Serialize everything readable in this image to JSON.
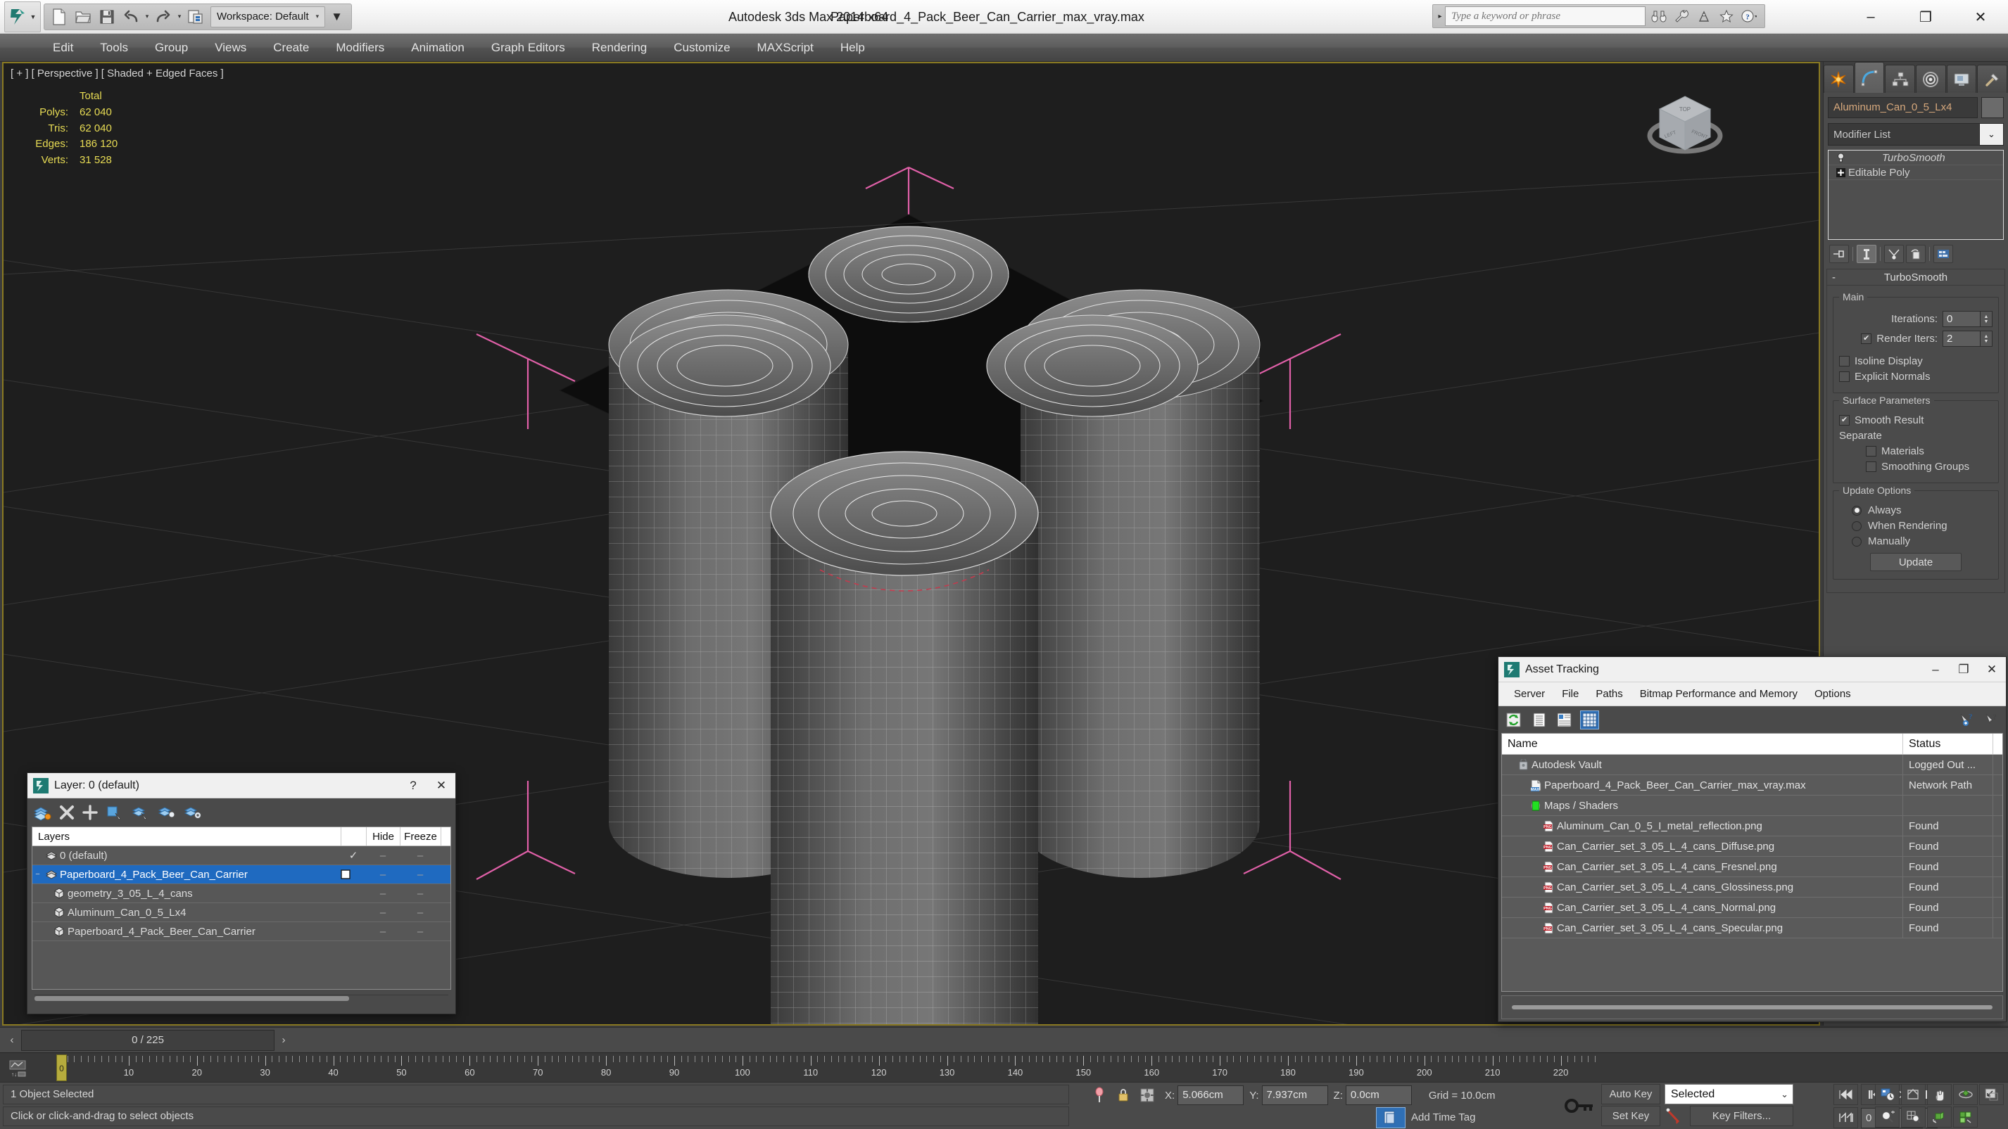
{
  "titlebar": {
    "app_title": "Autodesk 3ds Max  2014 x64",
    "file_title": "Paperboard_4_Pack_Beer_Can_Carrier_max_vray.max",
    "workspace_label": "Workspace: Default",
    "search_placeholder": "Type a keyword or phrase",
    "qat": [
      {
        "name": "new-file",
        "icon": "new-file-icon"
      },
      {
        "name": "open-file",
        "icon": "open-folder-icon"
      },
      {
        "name": "save-file",
        "icon": "save-disk-icon"
      },
      {
        "name": "undo",
        "icon": "undo-arrow-icon"
      },
      {
        "name": "redo",
        "icon": "redo-arrow-icon"
      },
      {
        "name": "project-folder",
        "icon": "project-folder-icon"
      }
    ],
    "search_icons": [
      "binoculars-icon",
      "wrench-icon",
      "satellite-icon",
      "star-icon",
      "help-circle-icon"
    ],
    "window_buttons": {
      "minimize": "–",
      "maximize": "❐",
      "close": "✕"
    }
  },
  "menubar": {
    "items": [
      "Edit",
      "Tools",
      "Group",
      "Views",
      "Create",
      "Modifiers",
      "Animation",
      "Graph Editors",
      "Rendering",
      "Customize",
      "MAXScript",
      "Help"
    ]
  },
  "viewport": {
    "label": "[ + ] [ Perspective ] [ Shaded + Edged Faces ]",
    "stats": {
      "header": "Total",
      "rows": [
        {
          "key": "Polys:",
          "value": "62 040"
        },
        {
          "key": "Tris:",
          "value": "62 040"
        },
        {
          "key": "Edges:",
          "value": "186 120"
        },
        {
          "key": "Verts:",
          "value": "31 528"
        }
      ]
    },
    "viewcube_faces": {
      "top": "TOP",
      "left": "LEFT",
      "front": "FRONT"
    }
  },
  "command_panel": {
    "tabs": [
      {
        "name": "create-tab",
        "icon": "create-star-icon",
        "active": false
      },
      {
        "name": "modify-tab",
        "icon": "modify-curve-icon",
        "active": true
      },
      {
        "name": "hierarchy-tab",
        "icon": "hierarchy-icon",
        "active": false
      },
      {
        "name": "motion-tab",
        "icon": "motion-wheel-icon",
        "active": false
      },
      {
        "name": "display-tab",
        "icon": "display-monitor-icon",
        "active": false
      },
      {
        "name": "utilities-tab",
        "icon": "utilities-hammer-icon",
        "active": false
      }
    ],
    "object_name": "Aluminum_Can_0_5_Lx4",
    "modifier_list_label": "Modifier List",
    "stack": [
      {
        "label": "TurboSmooth",
        "icon": "lightbulb-icon",
        "italic": true
      },
      {
        "label": "Editable Poly",
        "icon": "plus-box-icon",
        "italic": false
      }
    ],
    "stack_buttons": [
      "pin-stack-icon",
      "show-end-result-icon",
      "make-unique-icon",
      "remove-modifier-icon",
      "configure-sets-icon"
    ],
    "rollout": {
      "title": "TurboSmooth",
      "collapse_glyph": "-",
      "groups": {
        "main": {
          "title": "Main",
          "iterations_label": "Iterations:",
          "iterations_value": "0",
          "render_iters_label": "Render Iters:",
          "render_iters_value": "2",
          "render_iters_checked": true,
          "isoline_label": "Isoline Display",
          "isoline_checked": false,
          "explicit_normals_label": "Explicit Normals",
          "explicit_normals_checked": false
        },
        "surface": {
          "title": "Surface Parameters",
          "smooth_result_label": "Smooth Result",
          "smooth_result_checked": true,
          "separate_label": "Separate",
          "materials_label": "Materials",
          "materials_checked": false,
          "smoothing_groups_label": "Smoothing Groups",
          "smoothing_groups_checked": false
        },
        "update": {
          "title": "Update Options",
          "options": [
            {
              "label": "Always",
              "selected": true
            },
            {
              "label": "When Rendering",
              "selected": false
            },
            {
              "label": "Manually",
              "selected": false
            }
          ],
          "update_button": "Update"
        }
      }
    }
  },
  "layer_dialog": {
    "title": "Layer: 0 (default)",
    "help_glyph": "?",
    "close_glyph": "✕",
    "toolbar_icons": [
      "create-new-layer-icon",
      "delete-layer-icon",
      "add-to-layer-icon",
      "select-objects-in-layer-icon",
      "select-highlighted-layer-icon",
      "highlight-selected-objects-icon",
      "layer-properties-icon"
    ],
    "columns": {
      "name": "Layers",
      "hide": "Hide",
      "freeze": "Freeze"
    },
    "rows": [
      {
        "label": "0 (default)",
        "icon": "layer-icon",
        "indent": 1,
        "selected": false,
        "current": true,
        "expander": "",
        "hide": "–",
        "freeze": "–"
      },
      {
        "label": "Paperboard_4_Pack_Beer_Can_Carrier",
        "icon": "layer-icon",
        "indent": 1,
        "selected": true,
        "current": false,
        "expander": "−",
        "hide": "–",
        "freeze": "–"
      },
      {
        "label": "geometry_3_05_L_4_cans",
        "icon": "object-icon",
        "indent": 2,
        "selected": false,
        "current": false,
        "expander": "",
        "hide": "–",
        "freeze": "–"
      },
      {
        "label": "Aluminum_Can_0_5_Lx4",
        "icon": "object-icon",
        "indent": 2,
        "selected": false,
        "current": false,
        "expander": "",
        "hide": "–",
        "freeze": "–"
      },
      {
        "label": "Paperboard_4_Pack_Beer_Can_Carrier",
        "icon": "object-icon",
        "indent": 2,
        "selected": false,
        "current": false,
        "expander": "",
        "hide": "–",
        "freeze": "–"
      }
    ]
  },
  "asset_tracking": {
    "title": "Asset Tracking",
    "window_buttons": {
      "minimize": "–",
      "maximize": "❐",
      "close": "✕"
    },
    "menu": [
      "Server",
      "File",
      "Paths",
      "Bitmap Performance and Memory",
      "Options"
    ],
    "toolbar_icons": [
      "refresh-icon",
      "list-view-icon",
      "details-view-icon",
      "grid-view-icon"
    ],
    "toolbar_right_icons": [
      "help-add-icon",
      "help-pointer-icon"
    ],
    "columns": {
      "name": "Name",
      "status": "Status"
    },
    "rows": [
      {
        "label": "Autodesk Vault",
        "status": "Logged Out ...",
        "icon": "vault-icon",
        "indent": 1
      },
      {
        "label": "Paperboard_4_Pack_Beer_Can_Carrier_max_vray.max",
        "status": "Network Path",
        "icon": "max-file-icon",
        "indent": 2
      },
      {
        "label": "Maps / Shaders",
        "status": "",
        "icon": "maps-shaders-icon",
        "indent": 2
      },
      {
        "label": "Aluminum_Can_0_5_I_metal_reflection.png",
        "status": "Found",
        "icon": "png-icon",
        "indent": 3
      },
      {
        "label": "Can_Carrier_set_3_05_L_4_cans_Diffuse.png",
        "status": "Found",
        "icon": "png-icon",
        "indent": 3
      },
      {
        "label": "Can_Carrier_set_3_05_L_4_cans_Fresnel.png",
        "status": "Found",
        "icon": "png-icon",
        "indent": 3
      },
      {
        "label": "Can_Carrier_set_3_05_L_4_cans_Glossiness.png",
        "status": "Found",
        "icon": "png-icon",
        "indent": 3
      },
      {
        "label": "Can_Carrier_set_3_05_L_4_cans_Normal.png",
        "status": "Found",
        "icon": "png-icon",
        "indent": 3
      },
      {
        "label": "Can_Carrier_set_3_05_L_4_cans_Specular.png",
        "status": "Found",
        "icon": "png-icon",
        "indent": 3
      }
    ]
  },
  "time_slider": {
    "value": "0 / 225",
    "prev_glyph": "‹",
    "next_glyph": "›"
  },
  "track_bar": {
    "tick_labels": [
      "0",
      "10",
      "20",
      "30",
      "40",
      "50",
      "60",
      "70",
      "80",
      "90",
      "100",
      "110",
      "120",
      "130",
      "140",
      "150",
      "160",
      "170",
      "180",
      "190",
      "200",
      "210",
      "220"
    ],
    "frame_min": 0,
    "frame_max": 225,
    "current_frame": "0"
  },
  "status_bar": {
    "selection_text": "1 Object Selected",
    "prompt_text": "Click or click-and-drag to select objects",
    "coords": {
      "x_label": "X:",
      "x_value": "5.066cm",
      "y_label": "Y:",
      "y_value": "7.937cm",
      "z_label": "Z:",
      "z_value": "0.0cm"
    },
    "grid_text": "Grid = 10.0cm",
    "add_time_tag": "Add Time Tag",
    "auto_key": "Auto Key",
    "set_key": "Set Key",
    "key_mode_selected": "Selected",
    "key_filters": "Key Filters...",
    "key_frame_value": "0",
    "icons": [
      "pin-icon",
      "lock-selection-icon",
      "absolute-mode-icon",
      "key-toggle-icon"
    ],
    "nav_icons_row1": [
      "time-config-icon",
      "zoom-region-icon",
      "pan-icon",
      "orbit-icon",
      "maximize-viewport-icon"
    ],
    "nav_icons_row2": [
      "play-icon",
      "key-step-icon",
      "goto-start-icon",
      "zoom-icon",
      "zoom-all-icon",
      "zoom-extents-icon",
      "zoom-extents-all-icon"
    ]
  }
}
